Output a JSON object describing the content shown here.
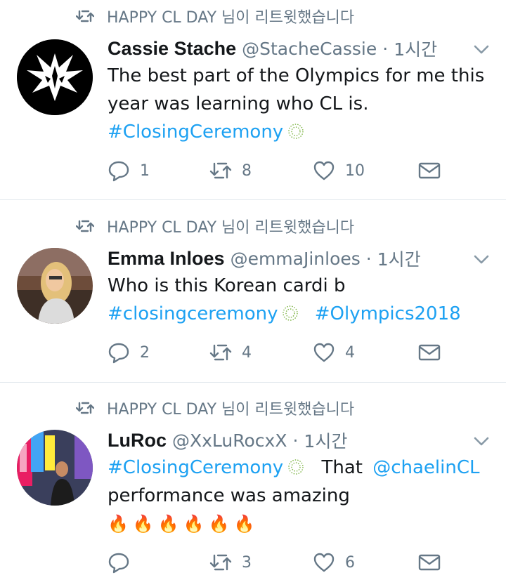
{
  "retweet_label": "HAPPY CL DAY 님이 리트윗했습니다",
  "tweets": [
    {
      "name": "Cassie Stache",
      "handle": "@StacheCassie",
      "dot": "·",
      "time": "1시간",
      "line1": "The best part of the Olympics for me this",
      "line2": "year was learning who CL is.",
      "hashtag1": "#ClosingCeremony",
      "replies": "1",
      "retweets": "8",
      "likes": "10"
    },
    {
      "name": "Emma Inloes",
      "handle": "@emmaJinloes",
      "dot": "·",
      "time": "1시간",
      "line1": "Who is this Korean cardi b",
      "hashtag1": "#closingceremony",
      "hashtag2": "#Olympics2018",
      "replies": "2",
      "retweets": "4",
      "likes": "4"
    },
    {
      "name": "LuRoc",
      "handle": "@XxLuRocxX",
      "dot": "·",
      "time": "1시간",
      "hashtag1": "#ClosingCeremony",
      "text_after": "That",
      "mention": "@chaelinCL",
      "line2": "performance was amazing",
      "emoji": "🔥",
      "replies": "",
      "retweets": "3",
      "likes": "6"
    }
  ],
  "colors": {
    "link": "#1da1f2",
    "muted": "#657786",
    "text": "#14171a"
  }
}
